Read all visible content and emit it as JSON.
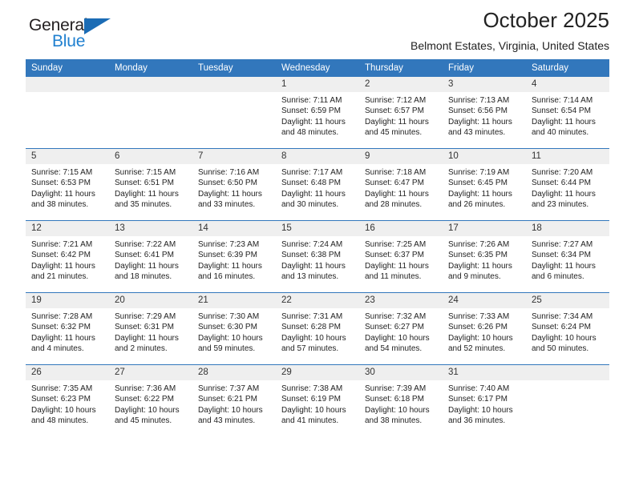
{
  "logo": {
    "primary_text": "General",
    "secondary_text": "Blue",
    "triangle_color": "#1b6cb5",
    "secondary_color": "#2080d0"
  },
  "header": {
    "title": "October 2025",
    "subtitle": "Belmont Estates, Virginia, United States"
  },
  "theme": {
    "header_bg": "#3277bc",
    "daynum_bg": "#efefef",
    "rule_color": "#3277bc",
    "text_color": "#222222"
  },
  "weekday_headers": [
    "Sunday",
    "Monday",
    "Tuesday",
    "Wednesday",
    "Thursday",
    "Friday",
    "Saturday"
  ],
  "weeks": [
    [
      {
        "day": "",
        "sunrise": "",
        "sunset": "",
        "daylight_line1": "",
        "daylight_line2": "",
        "empty": true
      },
      {
        "day": "",
        "sunrise": "",
        "sunset": "",
        "daylight_line1": "",
        "daylight_line2": "",
        "empty": true
      },
      {
        "day": "",
        "sunrise": "",
        "sunset": "",
        "daylight_line1": "",
        "daylight_line2": "",
        "empty": true
      },
      {
        "day": "1",
        "sunrise": "Sunrise: 7:11 AM",
        "sunset": "Sunset: 6:59 PM",
        "daylight_line1": "Daylight: 11 hours",
        "daylight_line2": "and 48 minutes.",
        "empty": false
      },
      {
        "day": "2",
        "sunrise": "Sunrise: 7:12 AM",
        "sunset": "Sunset: 6:57 PM",
        "daylight_line1": "Daylight: 11 hours",
        "daylight_line2": "and 45 minutes.",
        "empty": false
      },
      {
        "day": "3",
        "sunrise": "Sunrise: 7:13 AM",
        "sunset": "Sunset: 6:56 PM",
        "daylight_line1": "Daylight: 11 hours",
        "daylight_line2": "and 43 minutes.",
        "empty": false
      },
      {
        "day": "4",
        "sunrise": "Sunrise: 7:14 AM",
        "sunset": "Sunset: 6:54 PM",
        "daylight_line1": "Daylight: 11 hours",
        "daylight_line2": "and 40 minutes.",
        "empty": false
      }
    ],
    [
      {
        "day": "5",
        "sunrise": "Sunrise: 7:15 AM",
        "sunset": "Sunset: 6:53 PM",
        "daylight_line1": "Daylight: 11 hours",
        "daylight_line2": "and 38 minutes.",
        "empty": false
      },
      {
        "day": "6",
        "sunrise": "Sunrise: 7:15 AM",
        "sunset": "Sunset: 6:51 PM",
        "daylight_line1": "Daylight: 11 hours",
        "daylight_line2": "and 35 minutes.",
        "empty": false
      },
      {
        "day": "7",
        "sunrise": "Sunrise: 7:16 AM",
        "sunset": "Sunset: 6:50 PM",
        "daylight_line1": "Daylight: 11 hours",
        "daylight_line2": "and 33 minutes.",
        "empty": false
      },
      {
        "day": "8",
        "sunrise": "Sunrise: 7:17 AM",
        "sunset": "Sunset: 6:48 PM",
        "daylight_line1": "Daylight: 11 hours",
        "daylight_line2": "and 30 minutes.",
        "empty": false
      },
      {
        "day": "9",
        "sunrise": "Sunrise: 7:18 AM",
        "sunset": "Sunset: 6:47 PM",
        "daylight_line1": "Daylight: 11 hours",
        "daylight_line2": "and 28 minutes.",
        "empty": false
      },
      {
        "day": "10",
        "sunrise": "Sunrise: 7:19 AM",
        "sunset": "Sunset: 6:45 PM",
        "daylight_line1": "Daylight: 11 hours",
        "daylight_line2": "and 26 minutes.",
        "empty": false
      },
      {
        "day": "11",
        "sunrise": "Sunrise: 7:20 AM",
        "sunset": "Sunset: 6:44 PM",
        "daylight_line1": "Daylight: 11 hours",
        "daylight_line2": "and 23 minutes.",
        "empty": false
      }
    ],
    [
      {
        "day": "12",
        "sunrise": "Sunrise: 7:21 AM",
        "sunset": "Sunset: 6:42 PM",
        "daylight_line1": "Daylight: 11 hours",
        "daylight_line2": "and 21 minutes.",
        "empty": false
      },
      {
        "day": "13",
        "sunrise": "Sunrise: 7:22 AM",
        "sunset": "Sunset: 6:41 PM",
        "daylight_line1": "Daylight: 11 hours",
        "daylight_line2": "and 18 minutes.",
        "empty": false
      },
      {
        "day": "14",
        "sunrise": "Sunrise: 7:23 AM",
        "sunset": "Sunset: 6:39 PM",
        "daylight_line1": "Daylight: 11 hours",
        "daylight_line2": "and 16 minutes.",
        "empty": false
      },
      {
        "day": "15",
        "sunrise": "Sunrise: 7:24 AM",
        "sunset": "Sunset: 6:38 PM",
        "daylight_line1": "Daylight: 11 hours",
        "daylight_line2": "and 13 minutes.",
        "empty": false
      },
      {
        "day": "16",
        "sunrise": "Sunrise: 7:25 AM",
        "sunset": "Sunset: 6:37 PM",
        "daylight_line1": "Daylight: 11 hours",
        "daylight_line2": "and 11 minutes.",
        "empty": false
      },
      {
        "day": "17",
        "sunrise": "Sunrise: 7:26 AM",
        "sunset": "Sunset: 6:35 PM",
        "daylight_line1": "Daylight: 11 hours",
        "daylight_line2": "and 9 minutes.",
        "empty": false
      },
      {
        "day": "18",
        "sunrise": "Sunrise: 7:27 AM",
        "sunset": "Sunset: 6:34 PM",
        "daylight_line1": "Daylight: 11 hours",
        "daylight_line2": "and 6 minutes.",
        "empty": false
      }
    ],
    [
      {
        "day": "19",
        "sunrise": "Sunrise: 7:28 AM",
        "sunset": "Sunset: 6:32 PM",
        "daylight_line1": "Daylight: 11 hours",
        "daylight_line2": "and 4 minutes.",
        "empty": false
      },
      {
        "day": "20",
        "sunrise": "Sunrise: 7:29 AM",
        "sunset": "Sunset: 6:31 PM",
        "daylight_line1": "Daylight: 11 hours",
        "daylight_line2": "and 2 minutes.",
        "empty": false
      },
      {
        "day": "21",
        "sunrise": "Sunrise: 7:30 AM",
        "sunset": "Sunset: 6:30 PM",
        "daylight_line1": "Daylight: 10 hours",
        "daylight_line2": "and 59 minutes.",
        "empty": false
      },
      {
        "day": "22",
        "sunrise": "Sunrise: 7:31 AM",
        "sunset": "Sunset: 6:28 PM",
        "daylight_line1": "Daylight: 10 hours",
        "daylight_line2": "and 57 minutes.",
        "empty": false
      },
      {
        "day": "23",
        "sunrise": "Sunrise: 7:32 AM",
        "sunset": "Sunset: 6:27 PM",
        "daylight_line1": "Daylight: 10 hours",
        "daylight_line2": "and 54 minutes.",
        "empty": false
      },
      {
        "day": "24",
        "sunrise": "Sunrise: 7:33 AM",
        "sunset": "Sunset: 6:26 PM",
        "daylight_line1": "Daylight: 10 hours",
        "daylight_line2": "and 52 minutes.",
        "empty": false
      },
      {
        "day": "25",
        "sunrise": "Sunrise: 7:34 AM",
        "sunset": "Sunset: 6:24 PM",
        "daylight_line1": "Daylight: 10 hours",
        "daylight_line2": "and 50 minutes.",
        "empty": false
      }
    ],
    [
      {
        "day": "26",
        "sunrise": "Sunrise: 7:35 AM",
        "sunset": "Sunset: 6:23 PM",
        "daylight_line1": "Daylight: 10 hours",
        "daylight_line2": "and 48 minutes.",
        "empty": false
      },
      {
        "day": "27",
        "sunrise": "Sunrise: 7:36 AM",
        "sunset": "Sunset: 6:22 PM",
        "daylight_line1": "Daylight: 10 hours",
        "daylight_line2": "and 45 minutes.",
        "empty": false
      },
      {
        "day": "28",
        "sunrise": "Sunrise: 7:37 AM",
        "sunset": "Sunset: 6:21 PM",
        "daylight_line1": "Daylight: 10 hours",
        "daylight_line2": "and 43 minutes.",
        "empty": false
      },
      {
        "day": "29",
        "sunrise": "Sunrise: 7:38 AM",
        "sunset": "Sunset: 6:19 PM",
        "daylight_line1": "Daylight: 10 hours",
        "daylight_line2": "and 41 minutes.",
        "empty": false
      },
      {
        "day": "30",
        "sunrise": "Sunrise: 7:39 AM",
        "sunset": "Sunset: 6:18 PM",
        "daylight_line1": "Daylight: 10 hours",
        "daylight_line2": "and 38 minutes.",
        "empty": false
      },
      {
        "day": "31",
        "sunrise": "Sunrise: 7:40 AM",
        "sunset": "Sunset: 6:17 PM",
        "daylight_line1": "Daylight: 10 hours",
        "daylight_line2": "and 36 minutes.",
        "empty": false
      },
      {
        "day": "",
        "sunrise": "",
        "sunset": "",
        "daylight_line1": "",
        "daylight_line2": "",
        "empty": true
      }
    ]
  ]
}
